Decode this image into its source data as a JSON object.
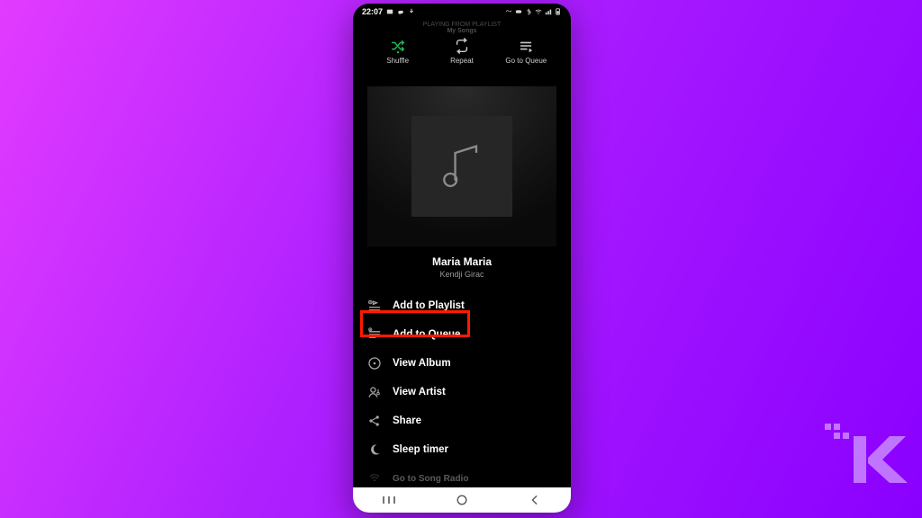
{
  "statusbar": {
    "time": "22:07"
  },
  "sheet_header_line1": "PLAYING FROM PLAYLIST",
  "sheet_header_line2": "My Songs",
  "top_actions": {
    "shuffle": "Shuffle",
    "repeat": "Repeat",
    "queue": "Go to Queue"
  },
  "track": {
    "title": "Maria Maria",
    "artist": "Kendji Girac"
  },
  "menu": [
    {
      "key": "add_playlist",
      "label": "Add to Playlist",
      "icon": "playlist-add-icon",
      "highlighted": true
    },
    {
      "key": "add_queue",
      "label": "Add to Queue",
      "icon": "queue-add-icon"
    },
    {
      "key": "view_album",
      "label": "View Album",
      "icon": "album-icon"
    },
    {
      "key": "view_artist",
      "label": "View Artist",
      "icon": "artist-icon"
    },
    {
      "key": "share",
      "label": "Share",
      "icon": "share-icon"
    },
    {
      "key": "sleep_timer",
      "label": "Sleep timer",
      "icon": "moon-icon"
    },
    {
      "key": "song_radio",
      "label": "Go to Song Radio",
      "icon": "radio-icon",
      "partial": true
    }
  ]
}
